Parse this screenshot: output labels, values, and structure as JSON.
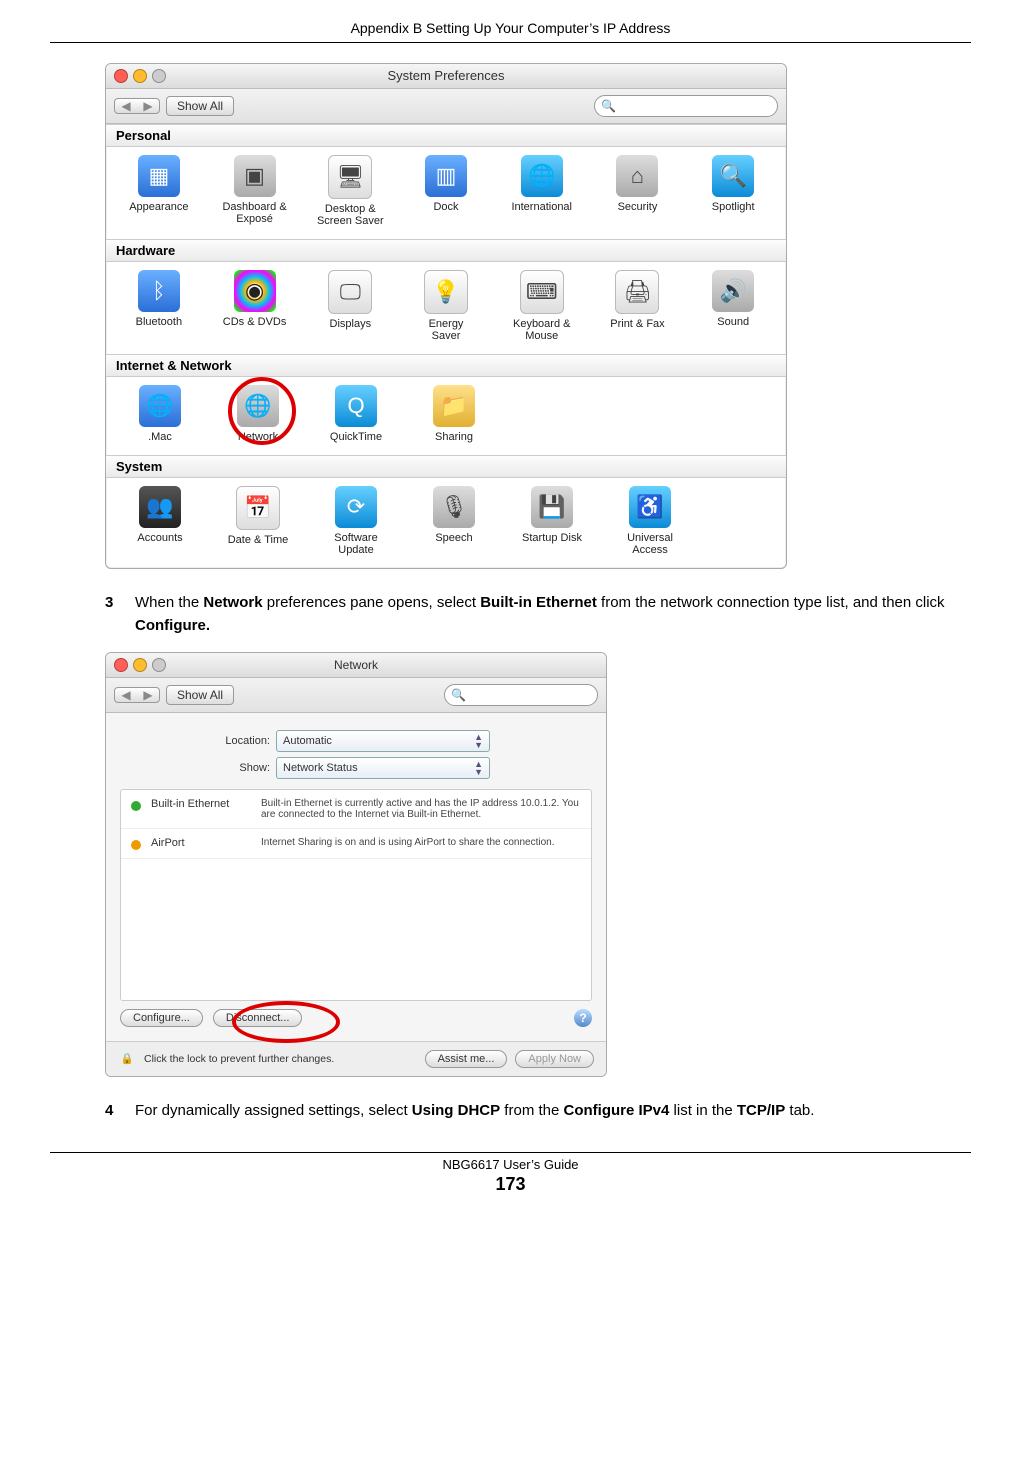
{
  "header": {
    "appendix": "Appendix B Setting Up Your Computer’s IP Address"
  },
  "syspref": {
    "title": "System Preferences",
    "show_all": "Show All",
    "search_placeholder": "",
    "search_glyph": "🔍",
    "sections": [
      {
        "name": "Personal",
        "items": [
          {
            "label": "Appearance",
            "glyph": "▦",
            "cls": "ic-blue"
          },
          {
            "label": "Dashboard &\nExposé",
            "glyph": "▣",
            "cls": "ic-grey"
          },
          {
            "label": "Desktop &\nScreen Saver",
            "glyph": "🖥",
            "cls": "ic-white"
          },
          {
            "label": "Dock",
            "glyph": "▥",
            "cls": "ic-blue"
          },
          {
            "label": "International",
            "glyph": "🌐",
            "cls": "ic-teal"
          },
          {
            "label": "Security",
            "glyph": "⌂",
            "cls": "ic-grey"
          },
          {
            "label": "Spotlight",
            "glyph": "🔍",
            "cls": "ic-teal"
          }
        ]
      },
      {
        "name": "Hardware",
        "items": [
          {
            "label": "Bluetooth",
            "glyph": "ᛒ",
            "cls": "ic-blue"
          },
          {
            "label": "CDs & DVDs",
            "glyph": "◉",
            "cls": "ic-cd"
          },
          {
            "label": "Displays",
            "glyph": "🖵",
            "cls": "ic-white"
          },
          {
            "label": "Energy\nSaver",
            "glyph": "💡",
            "cls": "ic-white"
          },
          {
            "label": "Keyboard &\nMouse",
            "glyph": "⌨",
            "cls": "ic-white"
          },
          {
            "label": "Print & Fax",
            "glyph": "🖨",
            "cls": "ic-white"
          },
          {
            "label": "Sound",
            "glyph": "🔊",
            "cls": "ic-grey"
          }
        ]
      },
      {
        "name": "Internet & Network",
        "items": [
          {
            "label": ".Mac",
            "glyph": "🌐",
            "cls": "ic-blue"
          },
          {
            "label": "Network",
            "glyph": "🌐",
            "cls": "ic-grey",
            "highlight": true
          },
          {
            "label": "QuickTime",
            "glyph": "Q",
            "cls": "ic-teal"
          },
          {
            "label": "Sharing",
            "glyph": "📁",
            "cls": "ic-yellow"
          }
        ]
      },
      {
        "name": "System",
        "items": [
          {
            "label": "Accounts",
            "glyph": "👥",
            "cls": "ic-dark"
          },
          {
            "label": "Date & Time",
            "glyph": "📅",
            "cls": "ic-white"
          },
          {
            "label": "Software\nUpdate",
            "glyph": "⟳",
            "cls": "ic-teal"
          },
          {
            "label": "Speech",
            "glyph": "🎙",
            "cls": "ic-grey"
          },
          {
            "label": "Startup Disk",
            "glyph": "💾",
            "cls": "ic-grey"
          },
          {
            "label": "Universal\nAccess",
            "glyph": "♿",
            "cls": "ic-teal"
          }
        ]
      }
    ]
  },
  "step3": {
    "num": "3",
    "t1": "When the ",
    "b1": "Network",
    "t2": " preferences pane opens, select ",
    "b2": "Built-in Ethernet",
    "t3": " from the network connection type list, and then click ",
    "b3": "Configure.",
    "t4": ""
  },
  "netwin": {
    "title": "Network",
    "show_all": "Show All",
    "location_lbl": "Location:",
    "location_val": "Automatic",
    "show_lbl": "Show:",
    "show_val": "Network Status",
    "rows": [
      {
        "color": "sd-green",
        "name": "Built-in Ethernet",
        "desc": "Built-in Ethernet is currently active and has the IP address 10.0.1.2. You are connected to the Internet via Built-in Ethernet."
      },
      {
        "color": "sd-orange",
        "name": "AirPort",
        "desc": "Internet Sharing is on and is using AirPort to share the connection."
      }
    ],
    "configure_btn": "Configure...",
    "disconnect_btn": "Disconnect...",
    "help_glyph": "?",
    "lock_text": "Click the lock to prevent further changes.",
    "assist_btn": "Assist me...",
    "apply_btn": "Apply Now"
  },
  "step4": {
    "num": "4",
    "t1": "For dynamically assigned settings, select ",
    "b1": "Using DHCP",
    "t2": " from the ",
    "b2": "Configure IPv4",
    "t3": " list in the ",
    "b3": "TCP/IP",
    "t4": " tab."
  },
  "footer": {
    "guide": "NBG6617 User’s Guide",
    "page": "173"
  }
}
